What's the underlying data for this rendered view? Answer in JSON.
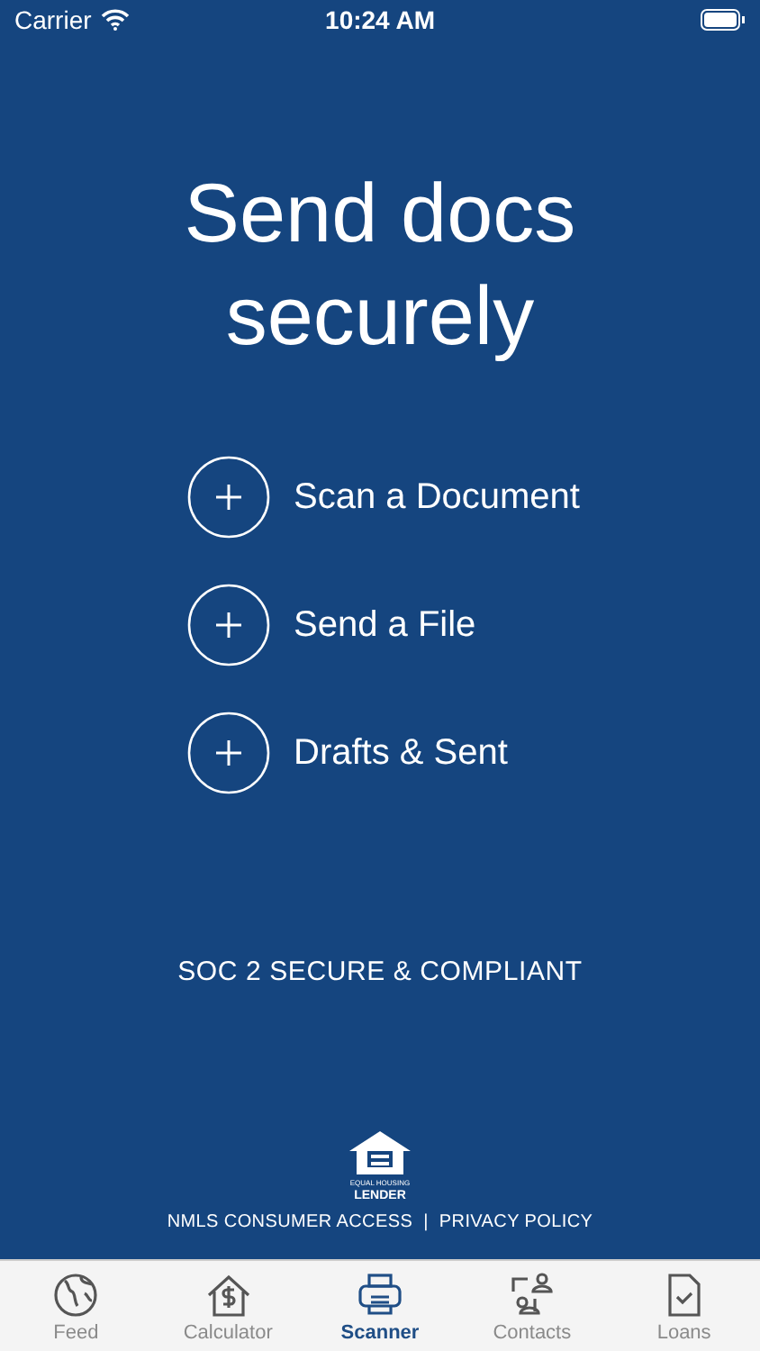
{
  "status_bar": {
    "carrier": "Carrier",
    "time": "10:24 AM"
  },
  "title": "Send docs securely",
  "actions": [
    {
      "label": "Scan a Document"
    },
    {
      "label": "Send a File"
    },
    {
      "label": "Drafts & Sent"
    }
  ],
  "compliance": "SOC 2 SECURE & COMPLIANT",
  "logo": {
    "top": "EQUAL HOUSING",
    "bottom": "LENDER"
  },
  "footer_links": [
    "NMLS CONSUMER ACCESS",
    "PRIVACY POLICY"
  ],
  "footer_separator": "|",
  "tabs": [
    {
      "label": "Feed",
      "kind": "globe",
      "selected": false
    },
    {
      "label": "Calculator",
      "kind": "house",
      "selected": false
    },
    {
      "label": "Scanner",
      "kind": "printer",
      "selected": true
    },
    {
      "label": "Contacts",
      "kind": "contacts",
      "selected": false
    },
    {
      "label": "Loans",
      "kind": "document",
      "selected": false
    }
  ]
}
